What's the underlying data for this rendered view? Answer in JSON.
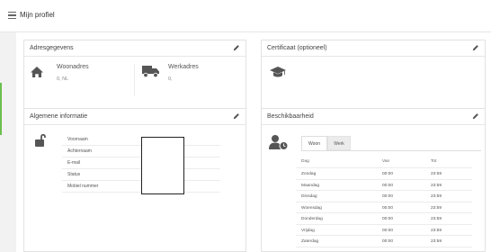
{
  "header": {
    "title": "Mijn profiel",
    "menu_icon": "hamburger-icon"
  },
  "adresgegevens": {
    "title": "Adresgegevens",
    "edit_icon": "pencil-icon",
    "woonadres": {
      "label": "Woonadres",
      "value": "0, NL",
      "icon": "house-icon"
    },
    "werkadres": {
      "label": "Werkadres",
      "value": "0,",
      "icon": "truck-icon"
    }
  },
  "certificaat": {
    "title": "Certificaat (optioneel)",
    "edit_icon": "pencil-icon",
    "icon": "graduation-cap-icon"
  },
  "algemene": {
    "title": "Algemene informatie",
    "edit_icon": "pencil-icon",
    "icon": "unlocked-padlock-icon",
    "fields": [
      "Voornaam",
      "Achternaam",
      "E-mail",
      "Status",
      "Mobiel nummer"
    ]
  },
  "beschikbaarheid": {
    "title": "Beschikbaarheid",
    "edit_icon": "pencil-icon",
    "icon": "user-clock-icon",
    "tabs": [
      "Woon",
      "Werk"
    ],
    "active_tab": "Woon",
    "columns": [
      "Dag",
      "Van",
      "Tot"
    ],
    "rows": [
      [
        "Zondag",
        "00:00",
        "23:59"
      ],
      [
        "Maandag",
        "00:00",
        "23:59"
      ],
      [
        "Dinsdag",
        "00:00",
        "23:59"
      ],
      [
        "Woensdag",
        "00:00",
        "23:59"
      ],
      [
        "Donderdag",
        "00:00",
        "23:59"
      ],
      [
        "Vrijdag",
        "00:00",
        "23:59"
      ],
      [
        "Zaterdag",
        "00:00",
        "23:59"
      ]
    ]
  },
  "colors": {
    "accent": "#6bbf4e",
    "text": "#444444",
    "icon": "#555555",
    "border": "#e2e2e2"
  }
}
